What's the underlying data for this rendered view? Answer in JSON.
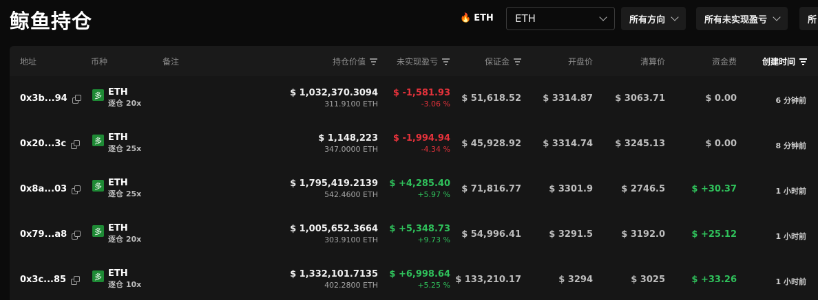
{
  "page": {
    "title": "鲸鱼持仓"
  },
  "filters": {
    "hot_label": "ETH",
    "coin_select_value": "ETH",
    "direction": "所有方向",
    "pnl": "所有未实现盈亏",
    "cut_label": "所"
  },
  "table": {
    "headers": {
      "address": "地址",
      "coin": "币种",
      "note": "备注",
      "position_value": "持仓价值",
      "unrealized_pnl": "未实现盈亏",
      "margin": "保证金",
      "entry_price": "开盘价",
      "liq_price": "清算价",
      "funding": "资金费",
      "created": "创建时间"
    },
    "rows": [
      {
        "address": "0x3b...94",
        "side": "多",
        "coin": "ETH",
        "leverage": "逐仓 20x",
        "value": "$ 1,032,370.3094",
        "amount": "311.9100 ETH",
        "pnl": "$ -1,581.93",
        "pnl_pct": "-3.06 %",
        "pnl_dir": "down",
        "margin": "$ 51,618.52",
        "entry": "$ 3314.87",
        "liq": "$ 3063.71",
        "funding": "$ 0.00",
        "funding_dir": "flat",
        "created": "6 分钟前"
      },
      {
        "address": "0x20...3c",
        "side": "多",
        "coin": "ETH",
        "leverage": "逐仓 25x",
        "value": "$ 1,148,223",
        "amount": "347.0000 ETH",
        "pnl": "$ -1,994.94",
        "pnl_pct": "-4.34 %",
        "pnl_dir": "down",
        "margin": "$ 45,928.92",
        "entry": "$ 3314.74",
        "liq": "$ 3245.13",
        "funding": "$ 0.00",
        "funding_dir": "flat",
        "created": "8 分钟前"
      },
      {
        "address": "0x8a...03",
        "side": "多",
        "coin": "ETH",
        "leverage": "逐仓 25x",
        "value": "$ 1,795,419.2139",
        "amount": "542.4600 ETH",
        "pnl": "$ +4,285.40",
        "pnl_pct": "+5.97 %",
        "pnl_dir": "up",
        "margin": "$ 71,816.77",
        "entry": "$ 3301.9",
        "liq": "$ 2746.5",
        "funding": "$ +30.37",
        "funding_dir": "up",
        "created": "1 小时前"
      },
      {
        "address": "0x79...a8",
        "side": "多",
        "coin": "ETH",
        "leverage": "逐仓 20x",
        "value": "$ 1,005,652.3664",
        "amount": "303.9100 ETH",
        "pnl": "$ +5,348.73",
        "pnl_pct": "+9.73 %",
        "pnl_dir": "up",
        "margin": "$ 54,996.41",
        "entry": "$ 3291.5",
        "liq": "$ 3192.0",
        "funding": "$ +25.12",
        "funding_dir": "up",
        "created": "1 小时前"
      },
      {
        "address": "0x3c...85",
        "side": "多",
        "coin": "ETH",
        "leverage": "逐仓 10x",
        "value": "$ 1,332,101.7135",
        "amount": "402.2800 ETH",
        "pnl": "$ +6,998.64",
        "pnl_pct": "+5.25 %",
        "pnl_dir": "up",
        "margin": "$ 133,210.17",
        "entry": "$ 3294",
        "liq": "$ 3025",
        "funding": "$ +33.26",
        "funding_dir": "up",
        "created": "1 小时前"
      }
    ]
  },
  "colors": {
    "up": "#2fc15b",
    "down": "#e5323b",
    "badge_long": "#1e8a35"
  }
}
